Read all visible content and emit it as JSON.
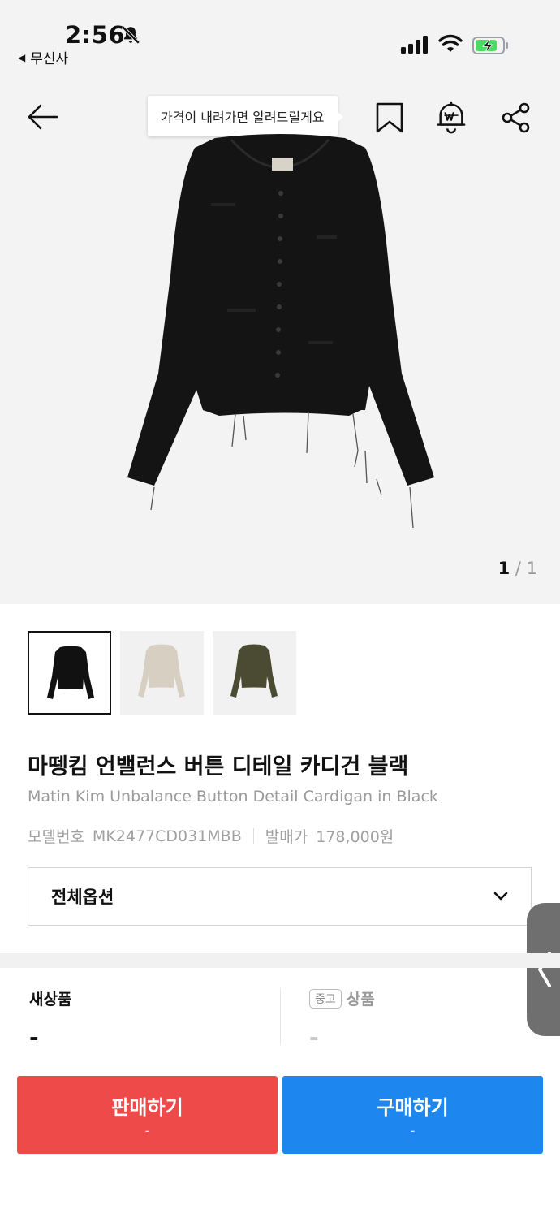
{
  "status_bar": {
    "time": "2:56",
    "back_app": "무신사",
    "icons": [
      "bell-off-icon",
      "cellular-signal-icon",
      "wifi-icon",
      "battery-charging-icon"
    ],
    "battery_color": "#4cd964"
  },
  "header": {
    "tooltip": "가격이 내려가면 알려드릴게요",
    "icons": [
      "back-arrow-icon",
      "bookmark-icon",
      "price-alert-icon",
      "share-icon"
    ]
  },
  "hero": {
    "image_counter_current": "1",
    "image_counter_total": "/ 1"
  },
  "thumbnails": [
    {
      "color": "#111111",
      "selected": true
    },
    {
      "color": "#d8cfc3",
      "selected": false
    },
    {
      "color": "#4b4a33",
      "selected": false
    }
  ],
  "product": {
    "title_ko": "마뗑킴 언밸런스 버튼 디테일 카디건 블랙",
    "title_en": "Matin Kim Unbalance Button Detail Cardigan in Black",
    "model_label": "모델번호",
    "model_value": "MK2477CD031MBB",
    "release_label": "발매가",
    "release_value": "178,000원"
  },
  "options": {
    "label": "전체옵션"
  },
  "prices": {
    "new_label": "새상품",
    "new_value": "-",
    "used_badge": "중고",
    "used_label": "상품",
    "used_value": "-"
  },
  "actions": {
    "sell_label": "판매하기",
    "sell_sub": "-",
    "buy_label": "구매하기",
    "buy_sub": "-"
  },
  "colors": {
    "sell": "#ef4a4a",
    "buy": "#1e86ef"
  }
}
